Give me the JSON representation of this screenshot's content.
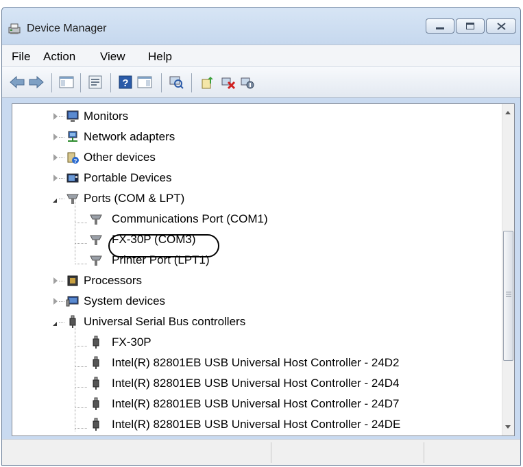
{
  "window": {
    "title": "Device Manager"
  },
  "menu": {
    "items": [
      "File",
      "Action",
      "View",
      "Help"
    ]
  },
  "toolbar": {
    "buttons": [
      "back-icon",
      "forward-icon",
      "show-hide-console-tree-icon",
      "properties-icon",
      "help-icon",
      "show-action-pane-icon",
      "scan-hardware-icon",
      "update-driver-icon",
      "uninstall-icon",
      "disable-icon"
    ]
  },
  "tree": {
    "rows": [
      {
        "label": "Monitors",
        "icon": "monitor-icon",
        "expander": "closed"
      },
      {
        "label": "Network adapters",
        "icon": "network-icon",
        "expander": "closed"
      },
      {
        "label": "Other devices",
        "icon": "unknown-device-icon",
        "expander": "closed"
      },
      {
        "label": "Portable Devices",
        "icon": "portable-device-icon",
        "expander": "closed"
      },
      {
        "label": "Ports (COM & LPT)",
        "icon": "port-icon",
        "expander": "open"
      },
      {
        "label": "Communications Port (COM1)",
        "icon": "port-icon"
      },
      {
        "label": "FX-30P (COM3)",
        "icon": "port-icon",
        "highlighted": true
      },
      {
        "label": "Printer Port (LPT1)",
        "icon": "port-icon"
      },
      {
        "label": "Processors",
        "icon": "processor-icon",
        "expander": "closed"
      },
      {
        "label": "System devices",
        "icon": "system-device-icon",
        "expander": "closed"
      },
      {
        "label": "Universal Serial Bus controllers",
        "icon": "usb-icon",
        "expander": "open"
      },
      {
        "label": "FX-30P",
        "icon": "usb-icon"
      },
      {
        "label": "Intel(R) 82801EB USB Universal Host Controller - 24D2",
        "icon": "usb-icon"
      },
      {
        "label": "Intel(R) 82801EB USB Universal Host Controller - 24D4",
        "icon": "usb-icon"
      },
      {
        "label": "Intel(R) 82801EB USB Universal Host Controller - 24D7",
        "icon": "usb-icon"
      },
      {
        "label": "Intel(R) 82801EB USB Universal Host Controller - 24DE",
        "icon": "usb-icon"
      }
    ]
  }
}
